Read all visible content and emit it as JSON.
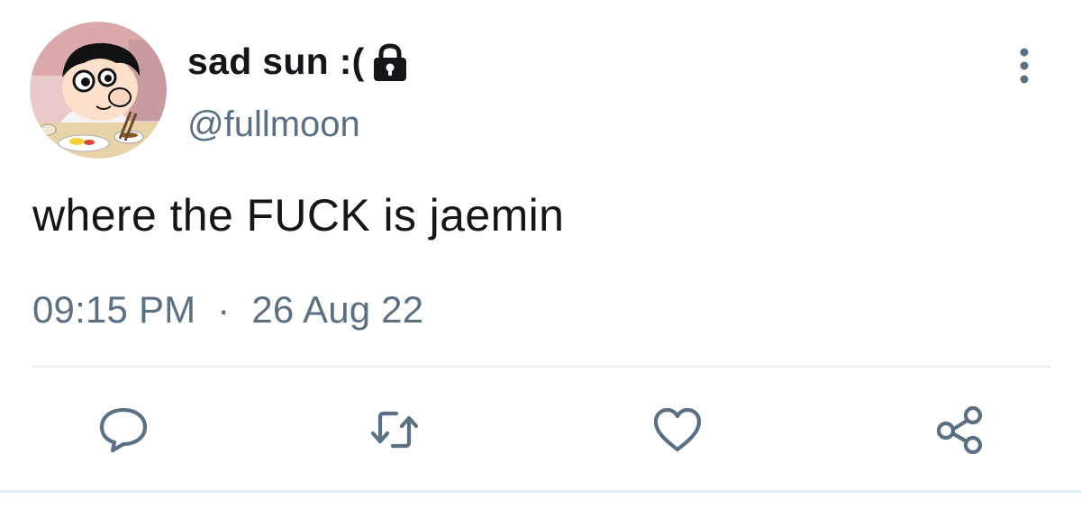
{
  "user": {
    "display_name": "sad sun :(",
    "handle": "@fullmoon",
    "protected_icon": "lock-icon",
    "avatar": "cartoon-boy-eating-avatar"
  },
  "tweet": {
    "text": "where the FUCK is jaemin",
    "time": "09:15 PM",
    "separator": "·",
    "date": "26 Aug 22"
  },
  "actions": [
    {
      "name": "reply",
      "icon": "speech-bubble-icon"
    },
    {
      "name": "retweet",
      "icon": "retweet-arrows-icon"
    },
    {
      "name": "like",
      "icon": "heart-icon"
    },
    {
      "name": "share",
      "icon": "share-nodes-icon"
    }
  ],
  "menu": {
    "icon": "vertical-ellipsis-icon"
  },
  "colors": {
    "text": "#14171a",
    "secondary": "#5b7083",
    "divider": "#e6ecf0"
  }
}
